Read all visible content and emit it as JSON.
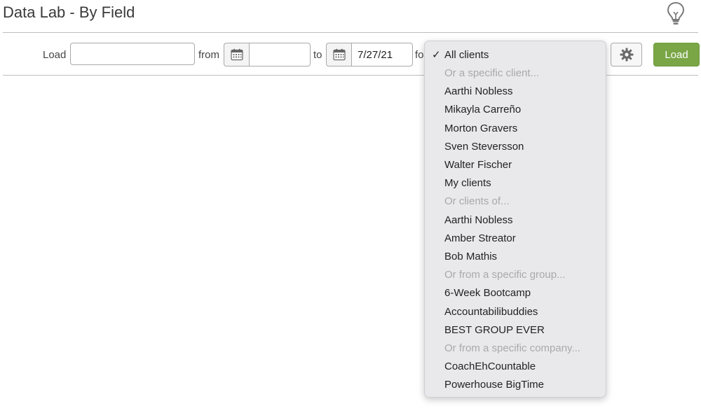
{
  "page": {
    "title": "Data Lab - By Field"
  },
  "toolbar": {
    "load_label": "Load",
    "load_value": "",
    "from_label": "from",
    "from_value": "",
    "to_label": "to",
    "to_value": "7/27/21",
    "for_label_partial": "fo",
    "load_button_label": "Load",
    "button_color": "#7aa646"
  },
  "client_dropdown": {
    "selected": "All clients",
    "items": [
      {
        "label": "All clients",
        "type": "option",
        "checked": true
      },
      {
        "label": "Or a specific client...",
        "type": "header"
      },
      {
        "label": "Aarthi Nobless",
        "type": "option"
      },
      {
        "label": "Mikayla Carreño",
        "type": "option"
      },
      {
        "label": "Morton Gravers",
        "type": "option"
      },
      {
        "label": "Sven Steversson",
        "type": "option"
      },
      {
        "label": "Walter Fischer",
        "type": "option"
      },
      {
        "label": "My clients",
        "type": "option"
      },
      {
        "label": "Or clients of...",
        "type": "header"
      },
      {
        "label": "Aarthi Nobless",
        "type": "option"
      },
      {
        "label": "Amber Streator",
        "type": "option"
      },
      {
        "label": "Bob Mathis",
        "type": "option"
      },
      {
        "label": "Or from a specific group...",
        "type": "header"
      },
      {
        "label": "6-Week Bootcamp",
        "type": "option"
      },
      {
        "label": "Accountabilibuddies",
        "type": "option"
      },
      {
        "label": "BEST GROUP EVER",
        "type": "option"
      },
      {
        "label": "Or from a specific company...",
        "type": "header"
      },
      {
        "label": "CoachEhCountable",
        "type": "option"
      },
      {
        "label": "Powerhouse BigTime",
        "type": "option"
      }
    ]
  },
  "icons": {
    "hint": "lightbulb-icon",
    "calendar": "calendar-icon",
    "settings": "gear-icon",
    "check": "checkmark-icon"
  }
}
